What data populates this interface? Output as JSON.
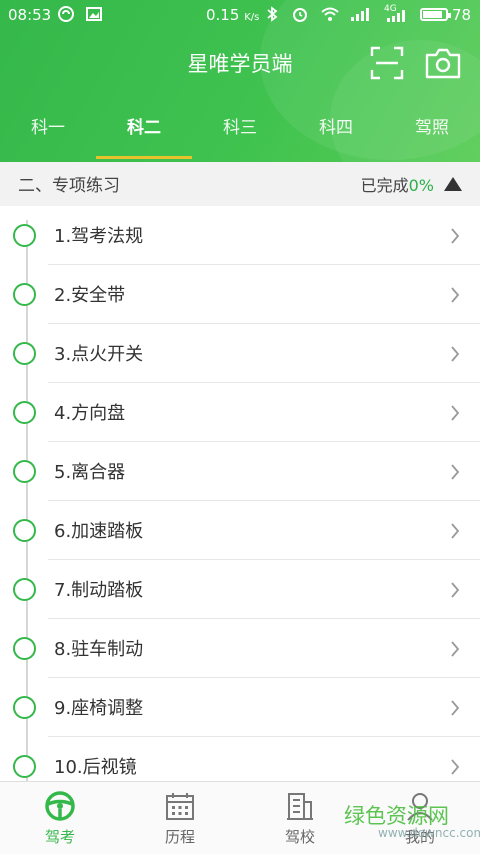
{
  "status_bar": {
    "time": "08:53",
    "speed": "0.15",
    "speed_unit": "K/s",
    "network": "4G",
    "battery": "78"
  },
  "header": {
    "title": "星唯学员端",
    "scan_icon": "scan-icon",
    "camera_icon": "camera-icon"
  },
  "tabs": [
    {
      "label": "科一",
      "active": false
    },
    {
      "label": "科二",
      "active": true
    },
    {
      "label": "科三",
      "active": false
    },
    {
      "label": "科四",
      "active": false
    },
    {
      "label": "驾照",
      "active": false
    }
  ],
  "section": {
    "title": "二、专项练习",
    "progress_label": "已完成",
    "progress_value": "0%"
  },
  "items": [
    {
      "label": "1.驾考法规"
    },
    {
      "label": "2.安全带"
    },
    {
      "label": "3.点火开关"
    },
    {
      "label": "4.方向盘"
    },
    {
      "label": "5.离合器"
    },
    {
      "label": "6.加速踏板"
    },
    {
      "label": "7.制动踏板"
    },
    {
      "label": "8.驻车制动"
    },
    {
      "label": "9.座椅调整"
    },
    {
      "label": "10.后视镜"
    }
  ],
  "bottom_nav": [
    {
      "label": "驾考",
      "icon": "steering-wheel-icon",
      "active": true
    },
    {
      "label": "历程",
      "icon": "calendar-icon",
      "active": false
    },
    {
      "label": "驾校",
      "icon": "building-icon",
      "active": false
    },
    {
      "label": "我的",
      "icon": "user-icon",
      "active": false
    }
  ],
  "watermark": {
    "text": "绿色资源网",
    "url": "www.downcc.com"
  },
  "colors": {
    "brand_green": "#35b84a",
    "tab_indicator": "#e8c12d",
    "progress_green": "#2bb04a"
  }
}
